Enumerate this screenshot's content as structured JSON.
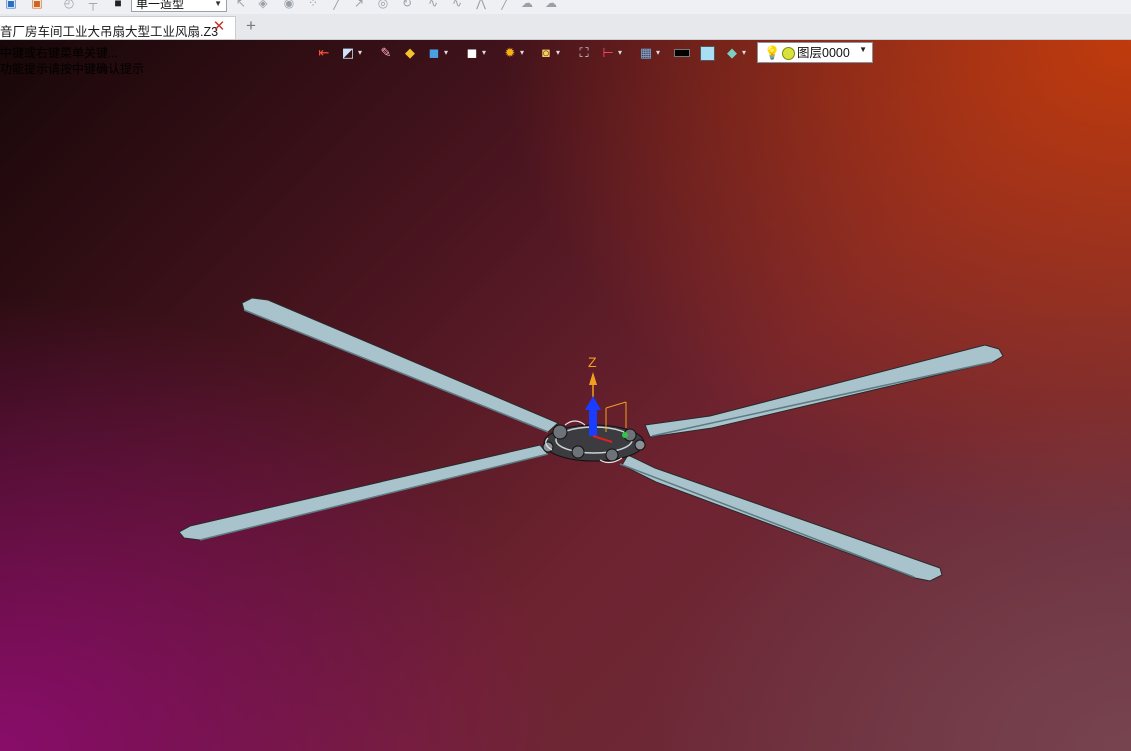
{
  "toolbar": {
    "combo_value": "单一造型",
    "icons": [
      "app-icon",
      "palette-icon",
      "undo-icon",
      "pin-icon",
      "stop-icon",
      "select-icon",
      "curve-icon",
      "sketch-icon"
    ]
  },
  "tabs": [
    {
      "label": "音厂房车间工业大吊扇大型工业风扇.Z3",
      "active": true
    }
  ],
  "tab_actions": {
    "close_glyph": "✕",
    "add_glyph": "+"
  },
  "viewport": {
    "hints": [
      "中键或右键菜单关键...",
      "功能提示请按中键确认提示"
    ],
    "layer": {
      "label": "图层0000"
    },
    "triad": {
      "z_label": "Z"
    },
    "colors": {
      "blade": "#a9c3cc",
      "blade_edge": "#2a2a2a",
      "axis_z": "#1a3cff",
      "axis_label": "#f0a020"
    }
  },
  "view_toolbar": {
    "buttons": [
      "exit-view-icon",
      "render-mode-icon",
      "pencil-icon",
      "stack-icon",
      "cube-shaded-icon",
      "cube-white-icon",
      "sun-icon",
      "zoom-view-icon",
      "fit-view-icon",
      "dimension-icon",
      "display-settings-icon",
      "color-black-icon",
      "color-white-icon",
      "layer-filter-icon"
    ]
  }
}
